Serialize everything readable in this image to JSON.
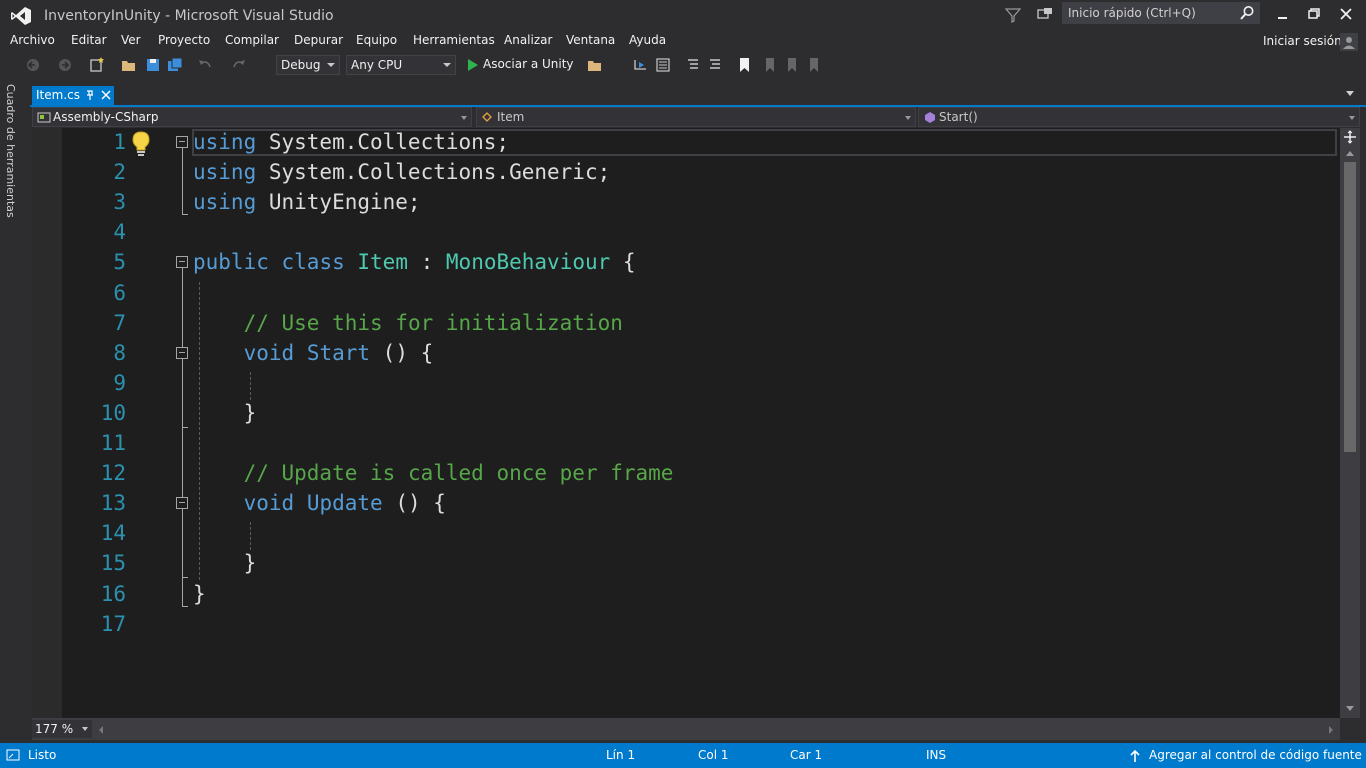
{
  "window": {
    "title": "InventoryInUnity - Microsoft Visual Studio",
    "quick_launch_placeholder": "Inicio rápido (Ctrl+Q)",
    "sign_in": "Iniciar sesión"
  },
  "menu": [
    "Archivo",
    "Editar",
    "Ver",
    "Proyecto",
    "Compilar",
    "Depurar",
    "Equipo",
    "Herramientas",
    "Analizar",
    "Ventana",
    "Ayuda"
  ],
  "toolbar": {
    "configuration": "Debug",
    "platform": "Any CPU",
    "run_label": "Asociar a Unity"
  },
  "toolbox_label": "Cuadro de herramientas",
  "tab": {
    "label": "Item.cs"
  },
  "navbar": {
    "project": "Assembly-CSharp",
    "type": "Item",
    "member": "Start()"
  },
  "editor": {
    "line_numbers": [
      "1",
      "2",
      "3",
      "4",
      "5",
      "6",
      "7",
      "8",
      "9",
      "10",
      "11",
      "12",
      "13",
      "14",
      "15",
      "16",
      "17"
    ],
    "lines": [
      {
        "parts": [
          {
            "c": "kw",
            "t": "using"
          },
          {
            "c": "id",
            "t": " System.Collections;"
          }
        ]
      },
      {
        "parts": [
          {
            "c": "kw",
            "t": "using"
          },
          {
            "c": "id",
            "t": " System.Collections.Generic;"
          }
        ]
      },
      {
        "parts": [
          {
            "c": "kw",
            "t": "using"
          },
          {
            "c": "id",
            "t": " UnityEngine;"
          }
        ]
      },
      {
        "parts": []
      },
      {
        "parts": [
          {
            "c": "kw",
            "t": "public"
          },
          {
            "c": "id",
            "t": " "
          },
          {
            "c": "kw",
            "t": "class"
          },
          {
            "c": "id",
            "t": " "
          },
          {
            "c": "ty",
            "t": "Item"
          },
          {
            "c": "id",
            "t": " : "
          },
          {
            "c": "ty",
            "t": "MonoBehaviour"
          },
          {
            "c": "id",
            "t": " {"
          }
        ]
      },
      {
        "parts": []
      },
      {
        "parts": [
          {
            "c": "id",
            "t": "    "
          },
          {
            "c": "cm",
            "t": "// Use this for initialization"
          }
        ]
      },
      {
        "parts": [
          {
            "c": "id",
            "t": "    "
          },
          {
            "c": "kw",
            "t": "void"
          },
          {
            "c": "id",
            "t": " "
          },
          {
            "c": "kw",
            "t": "Start"
          },
          {
            "c": "id",
            "t": " () {"
          }
        ]
      },
      {
        "parts": []
      },
      {
        "parts": [
          {
            "c": "id",
            "t": "    }"
          }
        ]
      },
      {
        "parts": []
      },
      {
        "parts": [
          {
            "c": "id",
            "t": "    "
          },
          {
            "c": "cm",
            "t": "// Update is called once per frame"
          }
        ]
      },
      {
        "parts": [
          {
            "c": "id",
            "t": "    "
          },
          {
            "c": "kw",
            "t": "void"
          },
          {
            "c": "id",
            "t": " "
          },
          {
            "c": "kw",
            "t": "Update"
          },
          {
            "c": "id",
            "t": " () {"
          }
        ]
      },
      {
        "parts": []
      },
      {
        "parts": [
          {
            "c": "id",
            "t": "    }"
          }
        ]
      },
      {
        "parts": [
          {
            "c": "id",
            "t": "}"
          }
        ]
      },
      {
        "parts": []
      }
    ],
    "zoom": "177 %"
  },
  "status": {
    "state": "Listo",
    "line": "Lín 1",
    "col": "Col 1",
    "char": "Car 1",
    "mode": "INS",
    "source_control": "Agregar al control de código fuente"
  },
  "colors": {
    "accent": "#007acc",
    "keyword": "#569cd6",
    "type": "#4ec9b0",
    "comment": "#57a64a",
    "line_number": "#2b91af",
    "editor_bg": "#1e1e1e"
  }
}
